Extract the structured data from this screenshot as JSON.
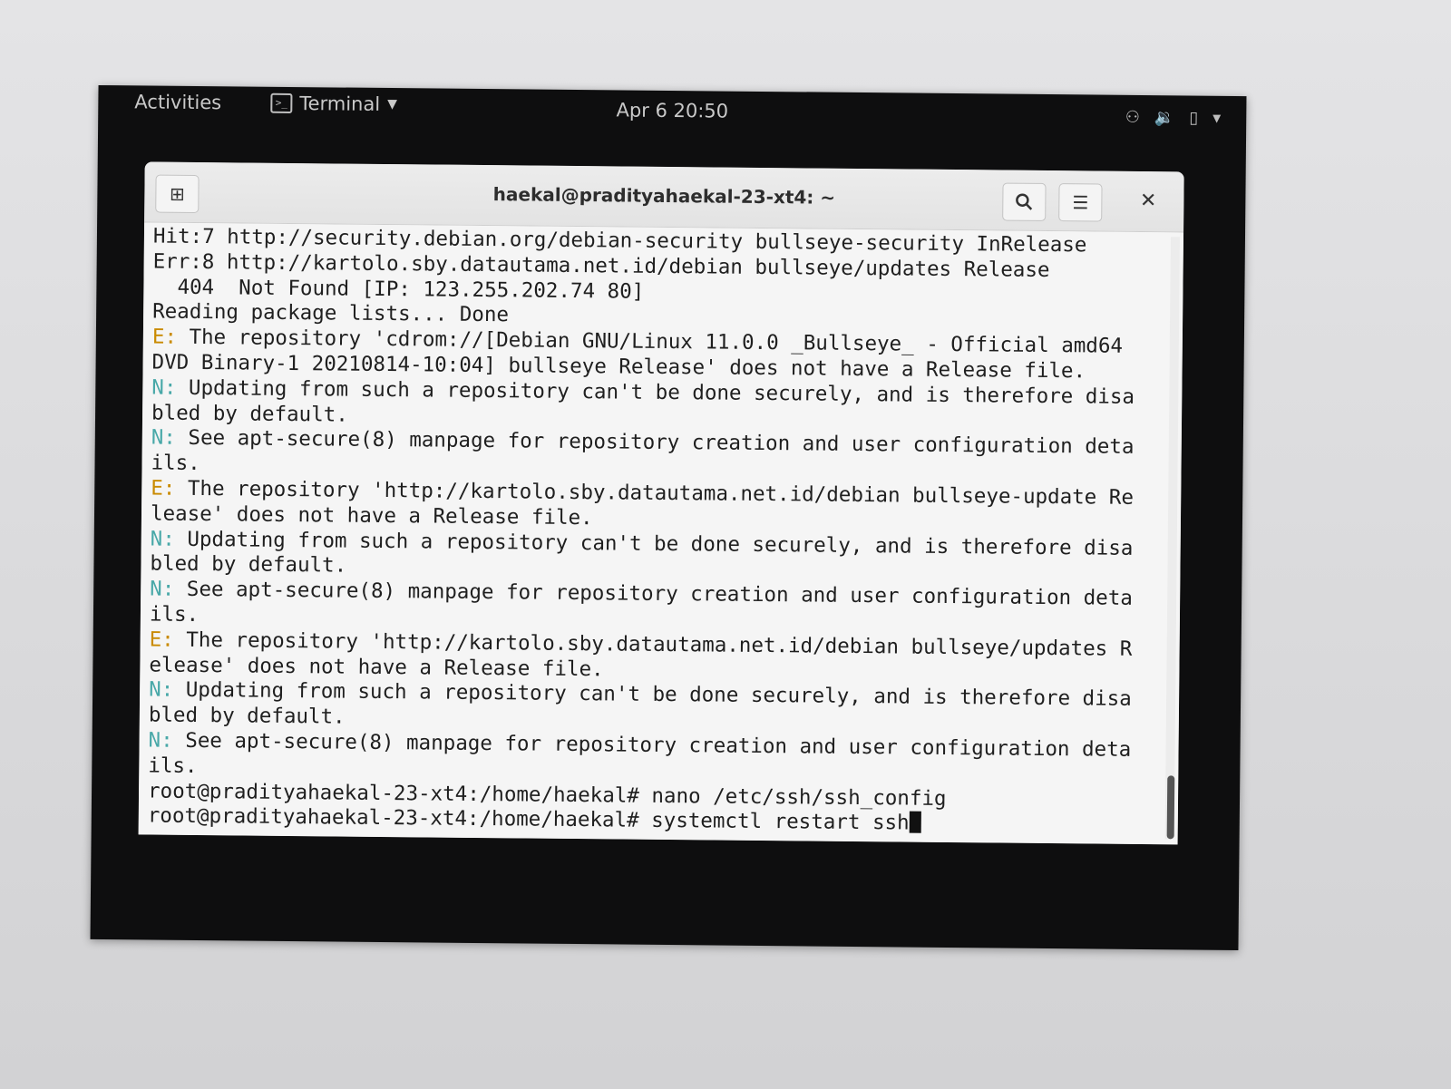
{
  "topbar": {
    "activities": "Activities",
    "app_name": "Terminal",
    "clock": "Apr 6  20:50",
    "tray_icons": [
      "network-icon",
      "volume-icon",
      "battery-icon",
      "chevron-down-icon"
    ]
  },
  "window": {
    "title": "haekal@pradityahaekal-23-xt4: ~",
    "buttons": [
      "new-tab-icon",
      "search-icon",
      "hamburger-menu-icon",
      "close-icon"
    ]
  },
  "terminal": {
    "lines": [
      {
        "prefix": "",
        "text": "Hit:7 http://security.debian.org/debian-security bullseye-security InRelease"
      },
      {
        "prefix": "",
        "text": "Err:8 http://kartolo.sby.datautama.net.id/debian bullseye/updates Release"
      },
      {
        "prefix": "",
        "text": "  404  Not Found [IP: 123.255.202.74 80]"
      },
      {
        "prefix": "",
        "text": "Reading package lists... Done"
      },
      {
        "prefix": "E:",
        "text": " The repository 'cdrom://[Debian GNU/Linux 11.0.0 _Bullseye_ - Official amd64"
      },
      {
        "prefix": "",
        "text": "DVD Binary-1 20210814-10:04] bullseye Release' does not have a Release file."
      },
      {
        "prefix": "N:",
        "text": " Updating from such a repository can't be done securely, and is therefore disa"
      },
      {
        "prefix": "",
        "text": "bled by default."
      },
      {
        "prefix": "N:",
        "text": " See apt-secure(8) manpage for repository creation and user configuration deta"
      },
      {
        "prefix": "",
        "text": "ils."
      },
      {
        "prefix": "E:",
        "text": " The repository 'http://kartolo.sby.datautama.net.id/debian bullseye-update Re"
      },
      {
        "prefix": "",
        "text": "lease' does not have a Release file."
      },
      {
        "prefix": "N:",
        "text": " Updating from such a repository can't be done securely, and is therefore disa"
      },
      {
        "prefix": "",
        "text": "bled by default."
      },
      {
        "prefix": "N:",
        "text": " See apt-secure(8) manpage for repository creation and user configuration deta"
      },
      {
        "prefix": "",
        "text": "ils."
      },
      {
        "prefix": "E:",
        "text": " The repository 'http://kartolo.sby.datautama.net.id/debian bullseye/updates R"
      },
      {
        "prefix": "",
        "text": "elease' does not have a Release file."
      },
      {
        "prefix": "N:",
        "text": " Updating from such a repository can't be done securely, and is therefore disa"
      },
      {
        "prefix": "",
        "text": "bled by default."
      },
      {
        "prefix": "N:",
        "text": " See apt-secure(8) manpage for repository creation and user configuration deta"
      },
      {
        "prefix": "",
        "text": "ils."
      },
      {
        "prefix": "",
        "text": "root@pradityahaekal-23-xt4:/home/haekal# nano /etc/ssh/ssh_config"
      },
      {
        "prefix": "",
        "text": "root@pradityahaekal-23-xt4:/home/haekal# systemctl restart ssh"
      }
    ]
  }
}
